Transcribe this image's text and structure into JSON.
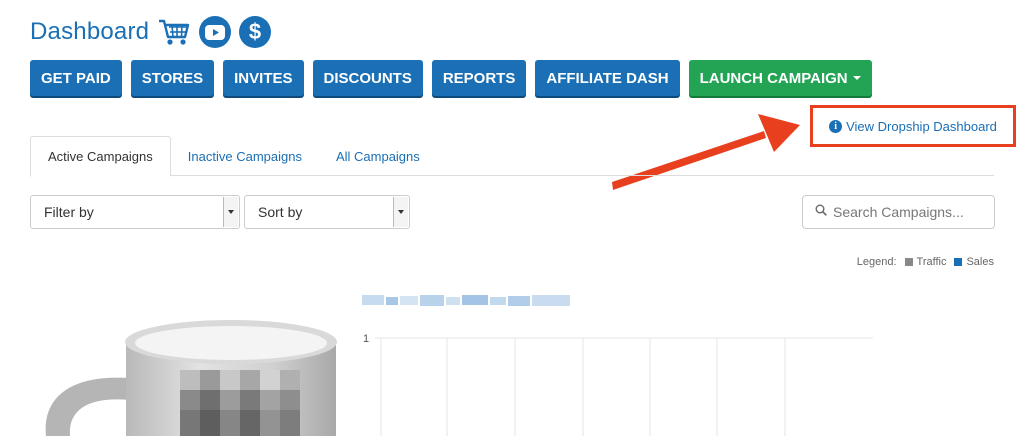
{
  "header": {
    "title": "Dashboard",
    "icons": [
      "cart-icon",
      "youtube-icon",
      "dollar-icon"
    ],
    "brand_color": "#1a6fb5"
  },
  "nav": {
    "buttons": [
      "GET PAID",
      "STORES",
      "INVITES",
      "DISCOUNTS",
      "REPORTS",
      "AFFILIATE DASH"
    ],
    "launch_label": "LAUNCH CAMPAIGN",
    "launch_color": "#23a455"
  },
  "dropship": {
    "label": "View Dropship Dashboard",
    "highlight_color": "#e8401f"
  },
  "tabs": [
    "Active Campaigns",
    "Inactive Campaigns",
    "All Campaigns"
  ],
  "filters": {
    "filter_label": "Filter by",
    "sort_label": "Sort by",
    "search_placeholder": "Search Campaigns..."
  },
  "legend": {
    "prefix": "Legend:",
    "items": [
      {
        "label": "Traffic",
        "color": "#888888"
      },
      {
        "label": "Sales",
        "color": "#1a6fb5"
      }
    ]
  },
  "chart": {
    "y_tick": "1"
  }
}
